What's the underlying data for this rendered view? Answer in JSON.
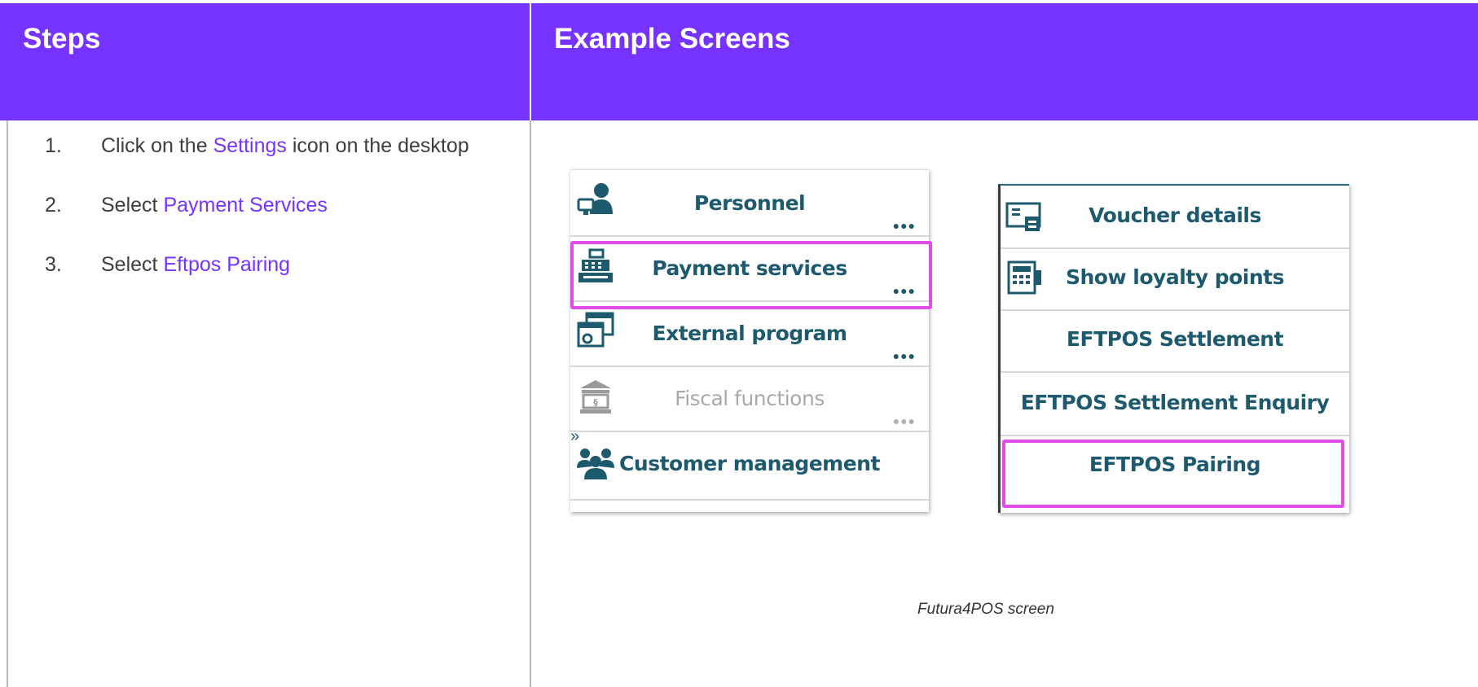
{
  "header": {
    "steps_title": "Steps",
    "examples_title": "Example Screens"
  },
  "steps": [
    {
      "num": "1.",
      "before": "Click on the ",
      "link": "Settings",
      "after": " icon on the desktop"
    },
    {
      "num": "2.",
      "before": "Select ",
      "link": "Payment Services",
      "after": ""
    },
    {
      "num": "3.",
      "before": "Select ",
      "link": "Eftpos Pairing",
      "after": ""
    }
  ],
  "colors": {
    "header_bg": "#7633ff",
    "link": "#7633ff",
    "highlight": "#e14ce8",
    "pos_text": "#1e5a6e"
  },
  "left_menu": {
    "items": [
      {
        "label": "Personnel",
        "icon": "personnel-icon",
        "dots": "●●●",
        "disabled": false
      },
      {
        "label": "Payment services",
        "icon": "cash-register-icon",
        "dots": "●●●",
        "disabled": false
      },
      {
        "label": "External program",
        "icon": "external-program-icon",
        "dots": "●●●",
        "disabled": false
      },
      {
        "label": "Fiscal functions",
        "icon": "bank-building-icon",
        "dots": "●●●",
        "disabled": true
      },
      {
        "label": "Customer management",
        "icon": "customers-icon",
        "dots": "",
        "disabled": false
      }
    ],
    "expand_glyph": "»"
  },
  "right_menu": {
    "items": [
      {
        "label": "Voucher details",
        "icon": "voucher-icon"
      },
      {
        "label": "Show loyalty points",
        "icon": "loyalty-card-icon"
      },
      {
        "label": "EFTPOS Settlement",
        "icon": ""
      },
      {
        "label": "EFTPOS Settlement Enquiry",
        "icon": ""
      },
      {
        "label": "EFTPOS Pairing",
        "icon": ""
      }
    ]
  },
  "caption": "Futura4POS screen"
}
